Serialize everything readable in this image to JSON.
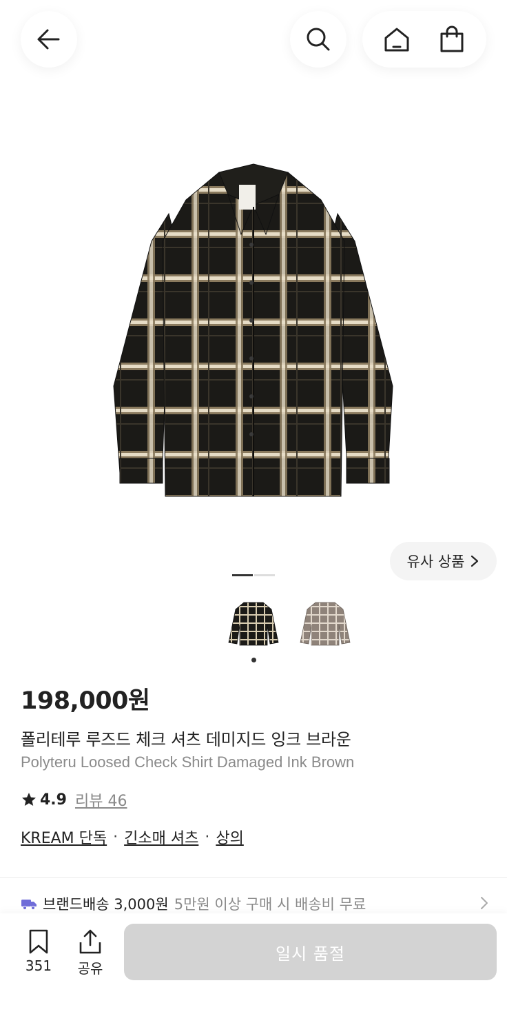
{
  "header": {
    "back_icon": "arrow-left-icon",
    "search_icon": "search-icon",
    "home_icon": "home-icon",
    "cart_icon": "shopping-bag-icon"
  },
  "gallery": {
    "similar_label": "유사 상품",
    "pager_total": 2,
    "pager_active": 1
  },
  "colors": {
    "primary_text": "#222222",
    "secondary_text": "#8a8a8a",
    "truck": "#6f6cd8",
    "soldout_bg": "#d3d3d3"
  },
  "product": {
    "price": "198,000원",
    "name_ko": "폴리테루 루즈드 체크 셔츠 데미지드 잉크 브라운",
    "name_en": "Polyteru Loosed Check Shirt Damaged Ink Brown",
    "rating": "4.9",
    "review_label": "리뷰 46",
    "tags": [
      "KREAM 단독",
      "긴소매 셔츠",
      "상의"
    ]
  },
  "shipping": {
    "main": "브랜드배송 3,000원",
    "sub": "5만원 이상 구매 시 배송비 무료"
  },
  "bottom": {
    "save_count": "351",
    "share_label": "공유",
    "buy_label": "일시 품절"
  }
}
